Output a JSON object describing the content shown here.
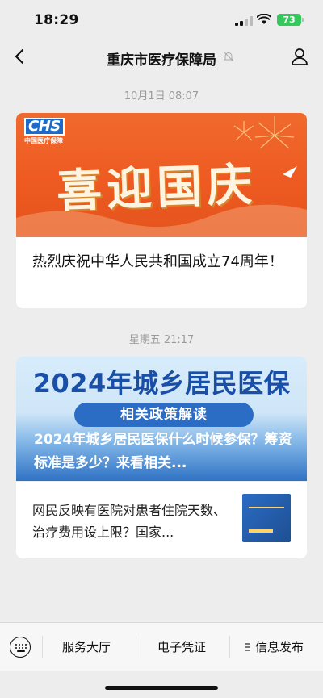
{
  "status_bar": {
    "time": "18:29",
    "battery": "73"
  },
  "nav": {
    "title": "重庆市医疗保障局"
  },
  "feed": {
    "timestamp1": "10月1日 08:07",
    "card1": {
      "logo_text": "CHS",
      "logo_sub": "中国医疗保障",
      "banner_text": "喜迎国庆",
      "title": "热烈庆祝中华人民共和国成立74周年！"
    },
    "timestamp2": "星期五 21:17",
    "card2": {
      "banner_heading": "2024年城乡居民医保",
      "banner_pill": "相关政策解读",
      "banner_caption": "2024年城乡居民医保什么时候参保？筹资标准是多少？来看相关...",
      "sub_title": "网民反映有医院对患者住院天数、治疗费用设上限？国家..."
    }
  },
  "bottom_menu": {
    "item1": "服务大厅",
    "item2": "电子凭证",
    "item3": "信息发布"
  },
  "colors": {
    "background": "#ededed",
    "battery": "#34c759",
    "banner1": "#ee5a22",
    "banner2": "#2b6cc4"
  }
}
